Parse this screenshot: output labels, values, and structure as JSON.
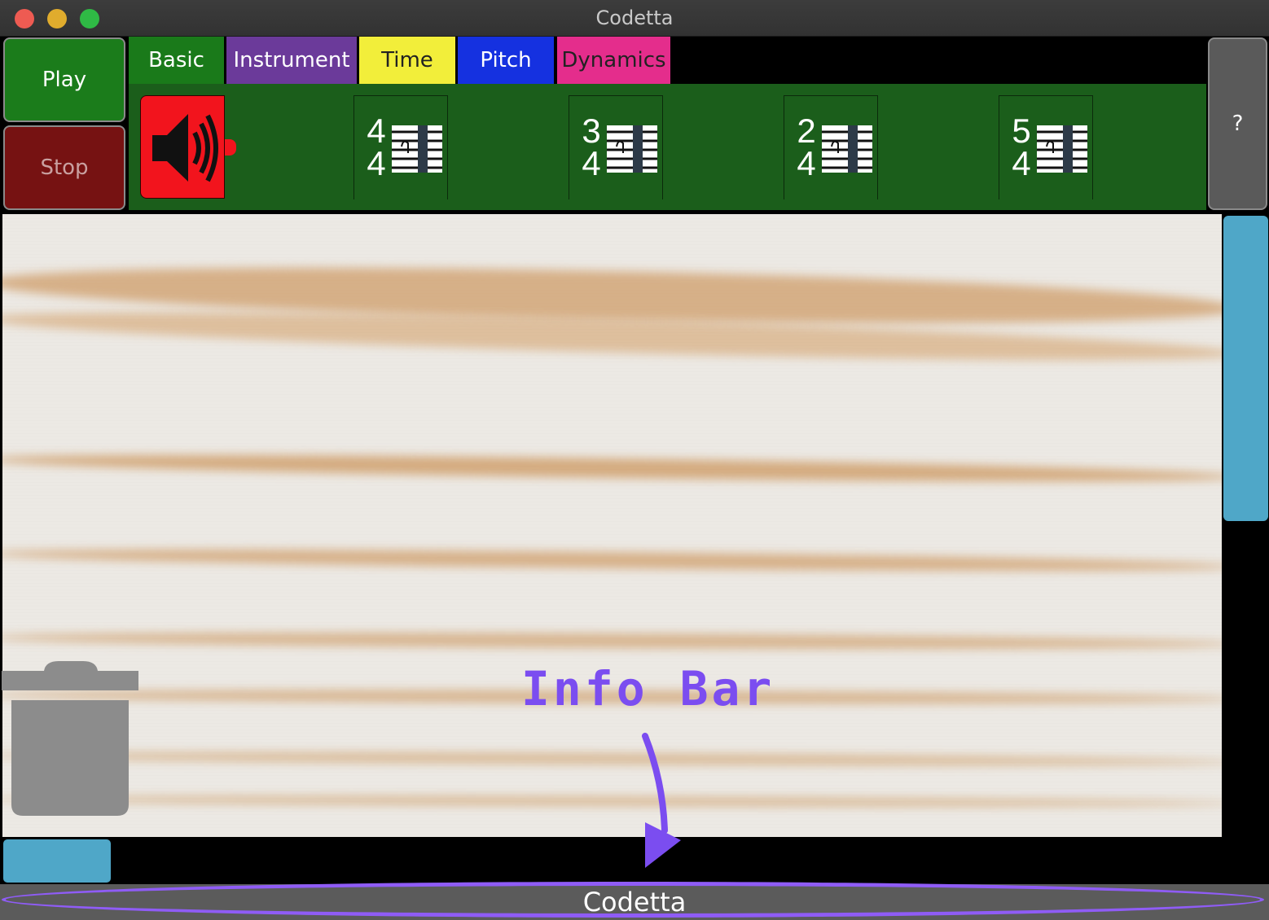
{
  "window": {
    "title": "Codetta"
  },
  "controls": {
    "play_label": "Play",
    "stop_label": "Stop",
    "help_label": "?"
  },
  "tabs": [
    {
      "label": "Basic"
    },
    {
      "label": "Instrument"
    },
    {
      "label": "Time"
    },
    {
      "label": "Pitch"
    },
    {
      "label": "Dynamics"
    }
  ],
  "palette": {
    "sound_block": {
      "icon": "speaker-icon"
    },
    "time_signatures": [
      {
        "top": "4",
        "bottom": "4"
      },
      {
        "top": "3",
        "bottom": "4"
      },
      {
        "top": "2",
        "bottom": "4"
      },
      {
        "top": "5",
        "bottom": "4"
      }
    ]
  },
  "annotation": {
    "text": "Info Bar"
  },
  "infobar": {
    "text": "Codetta"
  },
  "colors": {
    "play": "#1b7c1b",
    "stop": "#761212",
    "basic": "#1a7a1a",
    "instrument": "#6b3a9a",
    "time": "#f2ee3a",
    "pitch": "#1531e0",
    "dynamics": "#e42d8c",
    "scroll": "#4fa7c8",
    "annotation": "#7b4df0"
  }
}
